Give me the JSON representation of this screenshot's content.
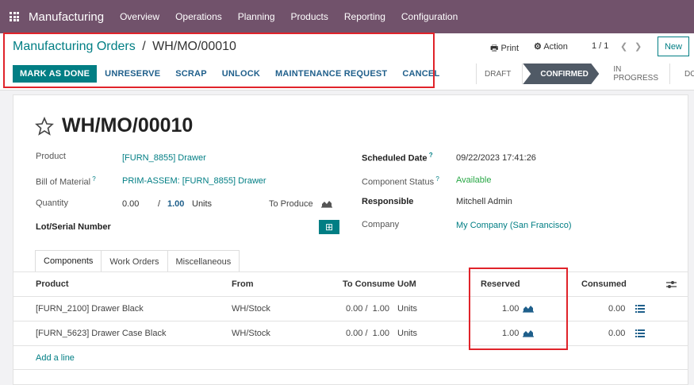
{
  "nav": {
    "brand": "Manufacturing",
    "menu": [
      "Overview",
      "Operations",
      "Planning",
      "Products",
      "Reporting",
      "Configuration"
    ]
  },
  "breadcrumb": {
    "parent": "Manufacturing Orders",
    "sep": "/",
    "current": "WH/MO/00010"
  },
  "toolbar": {
    "print": "Print",
    "action": "Action",
    "pager": "1 / 1",
    "new": "New"
  },
  "actions": [
    "MARK AS DONE",
    "UNRESERVE",
    "SCRAP",
    "UNLOCK",
    "MAINTENANCE REQUEST",
    "CANCEL"
  ],
  "statusbar": [
    "DRAFT",
    "CONFIRMED",
    "IN PROGRESS",
    "DONE"
  ],
  "record": {
    "name": "WH/MO/00010",
    "product_label": "Product",
    "product": "[FURN_8855] Drawer",
    "bom_label": "Bill of Material",
    "bom": "PRIM-ASSEM: [FURN_8855] Drawer",
    "qty_label": "Quantity",
    "qty_done": "0.00",
    "qty_sep": "/",
    "qty_total": "1.00",
    "qty_uom": "Units",
    "to_produce": "To Produce",
    "lot_label": "Lot/Serial Number",
    "sched_label": "Scheduled Date",
    "sched": "09/22/2023 17:41:26",
    "comp_status_label": "Component Status",
    "comp_status": "Available",
    "resp_label": "Responsible",
    "resp": "Mitchell Admin",
    "company_label": "Company",
    "company": "My Company (San Francisco)"
  },
  "tabs": [
    "Components",
    "Work Orders",
    "Miscellaneous"
  ],
  "table": {
    "headers": [
      "Product",
      "From",
      "To Consume",
      "UoM",
      "Reserved",
      "Consumed"
    ],
    "rows": [
      {
        "product": "[FURN_2100] Drawer Black",
        "from": "WH/Stock",
        "consume": "0.00 /  1.00",
        "uom": "Units",
        "reserved": "1.00",
        "consumed": "0.00"
      },
      {
        "product": "[FURN_5623] Drawer Case Black",
        "from": "WH/Stock",
        "consume": "0.00 /  1.00",
        "uom": "Units",
        "reserved": "1.00",
        "consumed": "0.00"
      }
    ],
    "add_line": "Add a line"
  },
  "colors": {
    "brand": "#71526b",
    "accent": "#017e84",
    "highlight": "#e0232a"
  }
}
